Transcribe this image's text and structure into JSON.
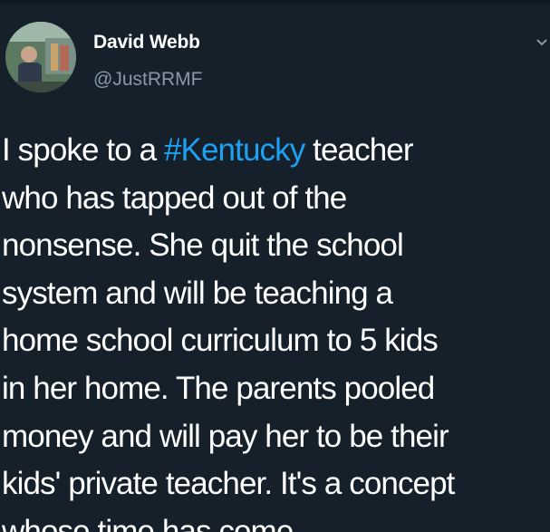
{
  "tweet": {
    "author_name": "David Webb",
    "author_handle": "@JustRRMF",
    "lines": [
      {
        "before": "I spoke to a ",
        "hashtag": "#Kentucky",
        "after": " teacher"
      },
      {
        "text": "who has tapped out of the"
      },
      {
        "text": "nonsense. She quit the school"
      },
      {
        "text": "system and will be teaching a"
      },
      {
        "text": "home school curriculum to 5 kids"
      },
      {
        "text": "in her home. The parents pooled"
      },
      {
        "text": "money and will pay her to be their"
      },
      {
        "text": "kids' private teacher. It's a concept"
      },
      {
        "text": "whose time has come"
      }
    ]
  },
  "icons": {
    "avatar": "avatar-photo",
    "menu": "chevron-down-icon"
  },
  "colors": {
    "background": "#15202b",
    "text": "#ffffff",
    "secondary_text": "#8899a6",
    "hashtag": "#1da1f2"
  }
}
